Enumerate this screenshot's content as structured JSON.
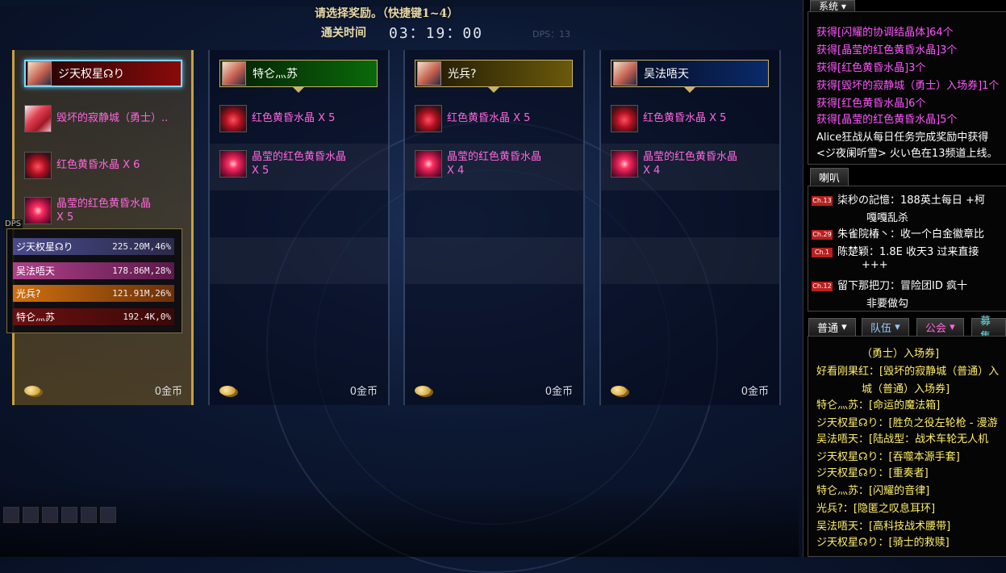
{
  "header": {
    "title": "请选择奖励。（快捷键1~4）",
    "timer_label": "通关时间",
    "timer": "03：19：00",
    "dps_faint": "DPS：13"
  },
  "columns": [
    {
      "name": "ジ天权星☊り",
      "items": [
        {
          "name": "毁坏的寂静城（勇士）..",
          "qty": ""
        },
        {
          "name": "红色黄昏水晶 X 6",
          "qty": ""
        },
        {
          "name": "晶莹的红色黄昏水晶",
          "qty": "X 5"
        }
      ],
      "gold": "0金币"
    },
    {
      "name": "特仑灬苏",
      "items": [
        {
          "name": "红色黄昏水晶 X 5",
          "qty": ""
        },
        {
          "name": "晶莹的红色黄昏水晶",
          "qty": "X 5"
        }
      ],
      "gold": "0金币"
    },
    {
      "name": "光兵?",
      "items": [
        {
          "name": "红色黄昏水晶 X 5",
          "qty": ""
        },
        {
          "name": "晶莹的红色黄昏水晶",
          "qty": "X 4"
        }
      ],
      "gold": "0金币"
    },
    {
      "name": "吴法唔天",
      "items": [
        {
          "name": "红色黄昏水晶 X 5",
          "qty": ""
        },
        {
          "name": "晶莹的红色黄昏水晶",
          "qty": "X 4"
        }
      ],
      "gold": "0金币"
    }
  ],
  "dps": {
    "label": "DPS",
    "rows": [
      {
        "name": "ジ天权星☊り",
        "value": "225.20M,46%",
        "color": "#4a4a8a"
      },
      {
        "name": "吴法唔天",
        "value": "178.86M,28%",
        "color": "#a0307a"
      },
      {
        "name": "光兵?",
        "value": "121.91M,26%",
        "color": "#c06010"
      },
      {
        "name": "特仑灬苏",
        "value": "192.4K,0%",
        "color": "#7a1a1a"
      }
    ]
  },
  "system": {
    "tab": "系统",
    "lines": [
      "获得[闪耀的协调结晶体]64个",
      "获得[晶莹的红色黄昏水晶]3个",
      "获得[红色黄昏水晶]3个",
      "获得[毁坏的寂静城（勇士）入场券]1个",
      "获得[红色黄昏水晶]6个",
      "获得[晶莹的红色黄昏水晶]5个",
      "Alice狂战从每日任务完成奖励中获得",
      "<ジ夜阑听雪> 火い色在13频道上线。"
    ]
  },
  "horn": {
    "tab": "喇叭",
    "lines": [
      {
        "ch": "Ch.13",
        "text": "柒秒の記憶：188英土每日  +柯",
        "cont": "嘎嘎乱杀"
      },
      {
        "ch": "Ch.29",
        "text": "朱雀院椿丶：收一个白金徽章比",
        "cont": ""
      },
      {
        "ch": "Ch.1",
        "text": "陈楚颖：1.8E  收天3 过来直接",
        "cont": "+++"
      },
      {
        "ch": "Ch.12",
        "text": "留下那把刀：冒险团ID   疯十",
        "cont": "非要做勾"
      }
    ]
  },
  "chat": {
    "tabs": [
      "普通",
      "队伍",
      "公会",
      "募集"
    ],
    "lines": [
      {
        "t": "（勇士）入场券]",
        "c": "yel",
        "indent": true
      },
      {
        "t": "好看刚果红：[毁坏的寂静城（普通）入",
        "c": "yel",
        "indent": false
      },
      {
        "t": "城（普通）入场券]",
        "c": "yel",
        "indent": true
      },
      {
        "t": "特仑灬苏：[命运的魔法箱]",
        "c": "yel",
        "indent": false
      },
      {
        "t": "ジ天权星☊り：[胜负之役左轮枪 - 漫游",
        "c": "yel",
        "indent": false
      },
      {
        "t": "吴法唔天：[陆战型：战术车轮无人机",
        "c": "yel",
        "indent": false
      },
      {
        "t": "ジ天权星☊り：[吞噬本源手套]",
        "c": "yel",
        "indent": false
      },
      {
        "t": "ジ天权星☊り：[重奏者]",
        "c": "yel",
        "indent": false
      },
      {
        "t": "特仑灬苏：[闪耀的音律]",
        "c": "yel",
        "indent": false
      },
      {
        "t": "光兵?：[隐匿之叹息耳环]",
        "c": "yel",
        "indent": false
      },
      {
        "t": "吴法唔天：[高科技战术腰带]",
        "c": "yel",
        "indent": false
      },
      {
        "t": "ジ天权星☊り：[骑士的救赎]",
        "c": "yel",
        "indent": false
      }
    ]
  }
}
